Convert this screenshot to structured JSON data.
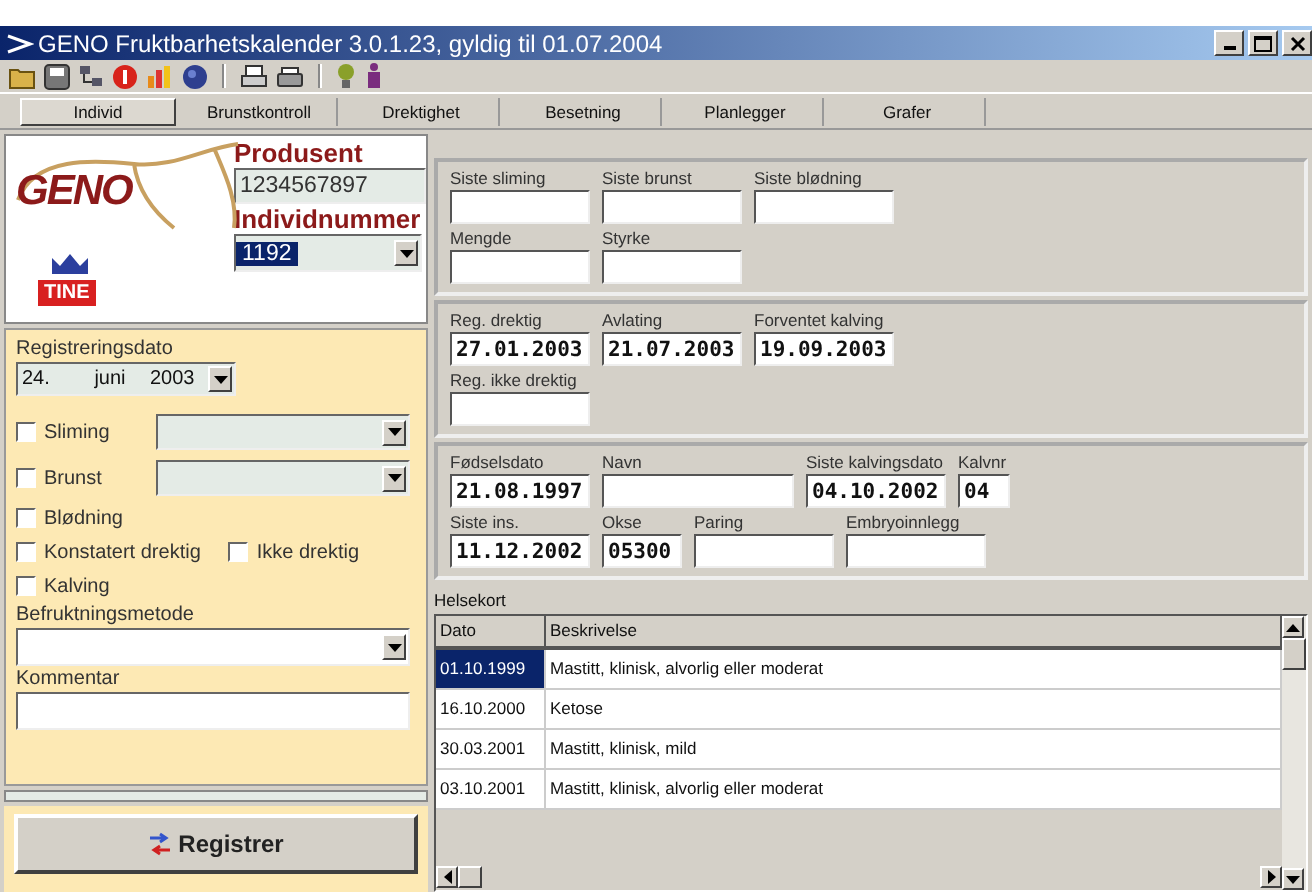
{
  "window": {
    "title": "GENO Fruktbarhetskalender 3.0.1.23, gyldig til 01.07.2004"
  },
  "tabs": [
    {
      "label": "Individ",
      "selected": true
    },
    {
      "label": "Brunstkontroll",
      "selected": false
    },
    {
      "label": "Drektighet",
      "selected": false
    },
    {
      "label": "Besetning",
      "selected": false
    },
    {
      "label": "Planlegger",
      "selected": false
    },
    {
      "label": "Grafer",
      "selected": false
    }
  ],
  "identity": {
    "logo": "GENO",
    "sub_logo": "TINE",
    "producer_label": "Produsent",
    "producer": "1234567897",
    "individual_label": "Individnummer",
    "individual": "1192",
    "individual_selected": true
  },
  "registration": {
    "date_label": "Registreringsdato",
    "day": "24.",
    "month": "juni",
    "year": "2003",
    "checks": [
      {
        "kind": "dropdown",
        "items": [
          {
            "label": "Sliming",
            "checked": false
          }
        ]
      },
      {
        "kind": "dropdown",
        "items": [
          {
            "label": "Brunst",
            "checked": false
          }
        ]
      },
      {
        "kind": "plain",
        "items": [
          {
            "label": "Blødning",
            "checked": false
          }
        ]
      },
      {
        "kind": "plain",
        "items": [
          {
            "label": "Konstatert drektig",
            "checked": false
          },
          {
            "label": "Ikke drektig",
            "checked": false
          }
        ]
      },
      {
        "kind": "plain",
        "items": [
          {
            "label": "Kalving",
            "checked": false
          }
        ]
      }
    ],
    "method_label": "Befruktningsmetode",
    "comment_label": "Kommentar",
    "button": "Registrer"
  },
  "groups": [
    {
      "lines": [
        {
          "fields": [
            {
              "label": "Siste sliming",
              "kind": "medium"
            },
            {
              "label": "Siste brunst",
              "kind": "medium"
            },
            {
              "label": "Siste blødning",
              "kind": "medium"
            }
          ]
        },
        {
          "fields": [
            {
              "label": "Mengde",
              "kind": "medium"
            },
            {
              "label": "Styrke",
              "kind": "medium"
            }
          ]
        }
      ]
    },
    {
      "lines": [
        {
          "fields": [
            {
              "label": "Reg. drektig",
              "value": "27.01.2003",
              "kind": "medium"
            },
            {
              "label": "Avlating",
              "value": "21.07.2003",
              "kind": "medium"
            },
            {
              "label": "Forventet kalving",
              "value": "19.09.2003",
              "kind": "medium"
            }
          ]
        },
        {
          "fields": [
            {
              "label": "Reg. ikke drektig",
              "kind": "medium"
            }
          ]
        }
      ]
    },
    {
      "lines": [
        {
          "fields": [
            {
              "label": "Fødselsdato",
              "value": "21.08.1997",
              "kind": "medium"
            },
            {
              "label": "Navn",
              "kind": "wide"
            },
            {
              "label": "Siste kalvingsdato",
              "value": "04.10.2002",
              "kind": "medium"
            },
            {
              "label": "Kalvnr",
              "value": "04",
              "kind": "tiny"
            }
          ]
        },
        {
          "fields": [
            {
              "label": "Siste ins.",
              "value": "11.12.2002",
              "kind": "medium"
            },
            {
              "label": "Okse",
              "value": "05300",
              "kind": "small"
            },
            {
              "label": "Paring",
              "kind": "medium"
            },
            {
              "label": "Embryoinnlegg",
              "kind": "medium"
            }
          ]
        }
      ]
    }
  ],
  "health": {
    "title": "Helsekort",
    "columns": [
      "Dato",
      "Beskrivelse"
    ],
    "rows": [
      {
        "date": "01.10.1999",
        "description": "Mastitt, klinisk, alvorlig eller moderat",
        "selected": true
      },
      {
        "date": "16.10.2000",
        "description": "Ketose",
        "selected": false
      },
      {
        "date": "30.03.2001",
        "description": "Mastitt, klinisk, mild",
        "selected": false
      },
      {
        "date": "03.10.2001",
        "description": "Mastitt, klinisk, alvorlig eller moderat",
        "selected": false
      }
    ]
  }
}
